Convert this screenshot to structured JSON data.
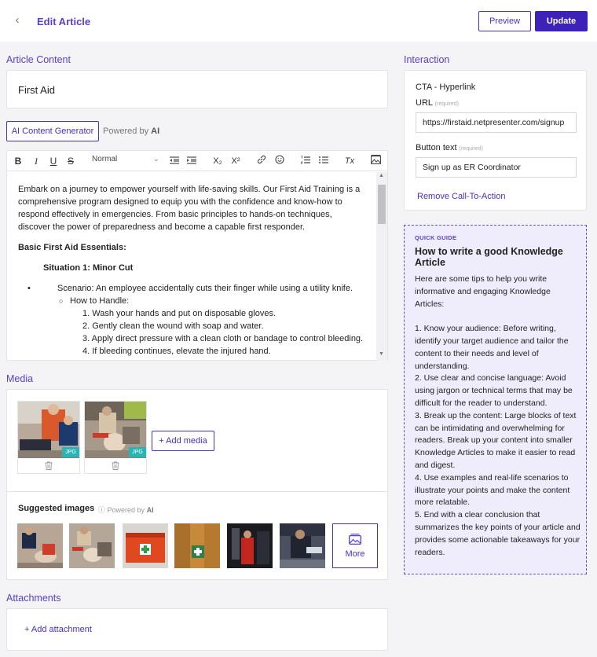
{
  "header": {
    "back_icon": "chevron-left-icon",
    "title": "Edit Article",
    "preview_label": "Preview",
    "update_label": "Update"
  },
  "article": {
    "section_label": "Article Content",
    "title_value": "First Aid",
    "ai_button_label": "AI Content Generator",
    "powered_prefix": "Powered by",
    "powered_brand": "AI"
  },
  "editor": {
    "toolbar": {
      "bold": "B",
      "italic": "I",
      "underline": "U",
      "strike": "S",
      "format_select": "Normal",
      "subscript": "X₂",
      "superscript": "X²",
      "clear": "Tx"
    },
    "content": {
      "intro": "Embark on a journey to empower yourself with life-saving skills. Our First Aid Training is a comprehensive program designed to equip you with the confidence and know-how to respond effectively in emergencies. From basic principles to hands-on techniques, discover the power of preparedness and become a capable first responder.",
      "heading": "Basic First Aid Essentials:",
      "subheading": "Situation 1: Minor Cut",
      "scenario": "Scenario: An employee accidentally cuts their finger while using a utility knife.",
      "how_to": "How to Handle:",
      "steps": [
        "1. Wash your hands and put on disposable gloves.",
        "2. Gently clean the wound with soap and water.",
        "3. Apply direct pressure with a clean cloth or bandage to control bleeding.",
        "4. If bleeding continues, elevate the injured hand."
      ]
    }
  },
  "media": {
    "section_label": "Media",
    "items": [
      {
        "badge": "JPG"
      },
      {
        "badge": "JPG"
      }
    ],
    "add_label": "+ Add media",
    "suggested_title": "Suggested images",
    "suggested_powered_prefix": "Powered by",
    "suggested_powered_brand": "AI",
    "more_label": "More"
  },
  "attachments": {
    "section_label": "Attachments",
    "add_label": "+ Add attachment"
  },
  "interaction": {
    "section_label": "Interaction",
    "cta_title": "CTA - Hyperlink",
    "url_label": "URL",
    "url_required": "(required)",
    "url_value": "https://firstaid.netpresenter.com/signup",
    "button_text_label": "Button text",
    "button_text_required": "(required)",
    "button_text_value": "Sign up as ER Coordinator",
    "remove_label": "Remove Call-To-Action"
  },
  "guide": {
    "eyebrow": "QUICK GUIDE",
    "title": "How to write a good Knowledge Article",
    "intro": "Here are some tips to help you write informative and engaging Knowledge Articles:",
    "tips": [
      "1. Know your audience: Before writing, identify your target audience and tailor the content to their needs and level of understanding.",
      "2. Use clear and concise language: Avoid using jargon or technical terms that may be difficult for the reader to understand.",
      "3. Break up the content: Large blocks of text can be intimidating and overwhelming for readers. Break up your content into smaller Knowledge Articles to make it easier to read and digest.",
      "4. Use examples and real-life scenarios to illustrate your points and make the content more relatable.",
      "5. End with a clear conclusion that summarizes the key points of your article and provides some actionable takeaways for your readers."
    ]
  },
  "colors": {
    "accent": "#4b2fbf",
    "accent_dark": "#3e22b8",
    "guide_bg": "#efedfb",
    "jpg_badge": "#2ab5b5"
  }
}
